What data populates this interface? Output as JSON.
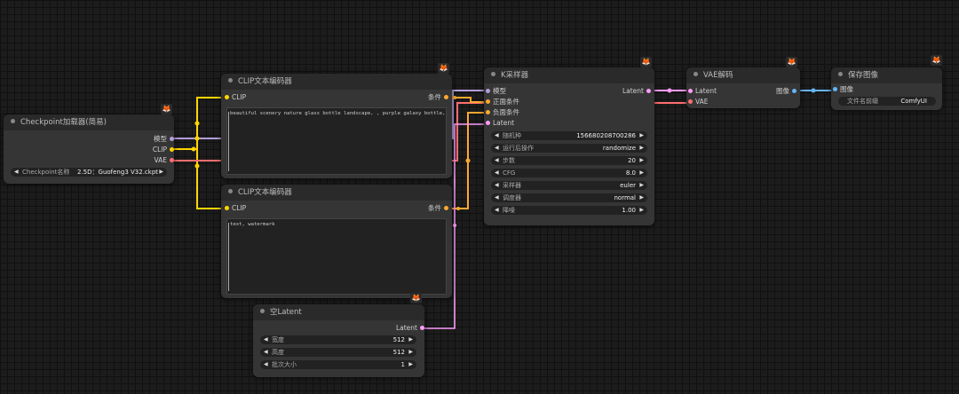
{
  "nodes": {
    "checkpoint": {
      "title": "Checkpoint加载器(简易)",
      "outputs": [
        "模型",
        "CLIP",
        "VAE"
      ],
      "widget": {
        "label": "Checkpoint名称",
        "value": "2.5D：Guofeng3 V32.ckpt"
      }
    },
    "clip_pos": {
      "title": "CLIP文本编码器",
      "input": "CLIP",
      "output": "条件",
      "text": "beautiful scenery nature glass bottle landscape, , purple galaxy bottle,"
    },
    "clip_neg": {
      "title": "CLIP文本编码器",
      "input": "CLIP",
      "output": "条件",
      "text": "text, watermark"
    },
    "empty_latent": {
      "title": "空Latent",
      "output": "Latent",
      "widgets": [
        {
          "label": "宽度",
          "value": "512"
        },
        {
          "label": "高度",
          "value": "512"
        },
        {
          "label": "批次大小",
          "value": "1"
        }
      ]
    },
    "ksampler": {
      "title": "K采样器",
      "inputs": [
        "模型",
        "正面条件",
        "负面条件",
        "Latent"
      ],
      "output": "Latent",
      "widgets": [
        {
          "label": "随机种",
          "value": "156680208700286"
        },
        {
          "label": "运行后操作",
          "value": "randomize"
        },
        {
          "label": "步数",
          "value": "20"
        },
        {
          "label": "CFG",
          "value": "8.0"
        },
        {
          "label": "采样器",
          "value": "euler"
        },
        {
          "label": "调度器",
          "value": "normal"
        },
        {
          "label": "降噪",
          "value": "1.00"
        }
      ]
    },
    "vae_decode": {
      "title": "VAE解码",
      "inputs": [
        "Latent",
        "VAE"
      ],
      "output": "图像"
    },
    "save_image": {
      "title": "保存图像",
      "input": "图像",
      "widget": {
        "label": "文件名前缀",
        "value": "ComfyUI"
      }
    }
  },
  "icons": {
    "node_badge": "fox-icon",
    "badge_glyph": "🦊",
    "arrow_left": "◀",
    "arrow_right": "▶"
  },
  "colors": {
    "model": "#b39ddb",
    "clip": "#ffd500",
    "vae": "#ff6e6e",
    "conditioning": "#ffa931",
    "latent": "#ff9cf9",
    "image": "#64b5f6"
  }
}
